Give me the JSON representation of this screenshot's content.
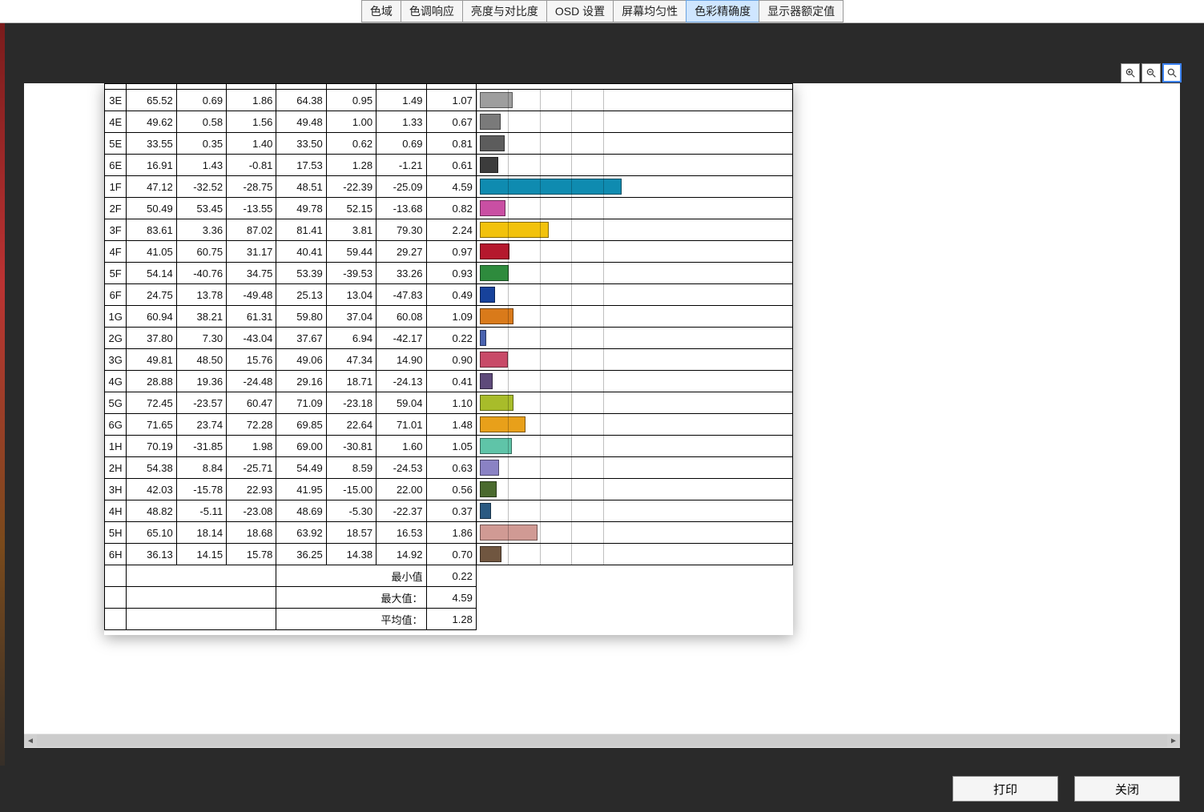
{
  "tabs": [
    "色域",
    "色调响应",
    "亮度与对比度",
    "OSD 设置",
    "屏幕均匀性",
    "色彩精确度",
    "显示器额定值"
  ],
  "active_tab_index": 5,
  "icons": {
    "zoom_in": "zoom-in-icon",
    "zoom_out": "zoom-out-icon",
    "zoom_fit": "zoom-fit-icon"
  },
  "buttons": {
    "print": "打印",
    "close": "关闭"
  },
  "summary_labels": {
    "min": "最小值",
    "max": "最大值：",
    "avg": "平均值："
  },
  "summary_values": {
    "min": "0.22",
    "max": "4.59",
    "avg": "1.28"
  },
  "chart_data": {
    "type": "bar",
    "xlabel": "",
    "ylabel": "",
    "xlim": [
      0,
      10
    ],
    "rows": [
      {
        "id": "3E",
        "c1": "65.52",
        "c2": "0.69",
        "c3": "1.86",
        "c4": "64.38",
        "c5": "0.95",
        "c6": "1.49",
        "value": 1.07,
        "color": "#9e9e9e"
      },
      {
        "id": "4E",
        "c1": "49.62",
        "c2": "0.58",
        "c3": "1.56",
        "c4": "49.48",
        "c5": "1.00",
        "c6": "1.33",
        "value": 0.67,
        "color": "#7a7a7a"
      },
      {
        "id": "5E",
        "c1": "33.55",
        "c2": "0.35",
        "c3": "1.40",
        "c4": "33.50",
        "c5": "0.62",
        "c6": "0.69",
        "value": 0.81,
        "color": "#5c5c5c"
      },
      {
        "id": "6E",
        "c1": "16.91",
        "c2": "1.43",
        "c3": "-0.81",
        "c4": "17.53",
        "c5": "1.28",
        "c6": "-1.21",
        "value": 0.61,
        "color": "#3c3c3c"
      },
      {
        "id": "1F",
        "c1": "47.12",
        "c2": "-32.52",
        "c3": "-28.75",
        "c4": "48.51",
        "c5": "-22.39",
        "c6": "-25.09",
        "value": 4.59,
        "color": "#0f8bb0"
      },
      {
        "id": "2F",
        "c1": "50.49",
        "c2": "53.45",
        "c3": "-13.55",
        "c4": "49.78",
        "c5": "52.15",
        "c6": "-13.68",
        "value": 0.82,
        "color": "#c94fa3"
      },
      {
        "id": "3F",
        "c1": "83.61",
        "c2": "3.36",
        "c3": "87.02",
        "c4": "81.41",
        "c5": "3.81",
        "c6": "79.30",
        "value": 2.24,
        "color": "#f2c20c"
      },
      {
        "id": "4F",
        "c1": "41.05",
        "c2": "60.75",
        "c3": "31.17",
        "c4": "40.41",
        "c5": "59.44",
        "c6": "29.27",
        "value": 0.97,
        "color": "#b5182d"
      },
      {
        "id": "5F",
        "c1": "54.14",
        "c2": "-40.76",
        "c3": "34.75",
        "c4": "53.39",
        "c5": "-39.53",
        "c6": "33.26",
        "value": 0.93,
        "color": "#2e8b3d"
      },
      {
        "id": "6F",
        "c1": "24.75",
        "c2": "13.78",
        "c3": "-49.48",
        "c4": "25.13",
        "c5": "13.04",
        "c6": "-47.83",
        "value": 0.49,
        "color": "#17429b"
      },
      {
        "id": "1G",
        "c1": "60.94",
        "c2": "38.21",
        "c3": "61.31",
        "c4": "59.80",
        "c5": "37.04",
        "c6": "60.08",
        "value": 1.09,
        "color": "#d97a1a"
      },
      {
        "id": "2G",
        "c1": "37.80",
        "c2": "7.30",
        "c3": "-43.04",
        "c4": "37.67",
        "c5": "6.94",
        "c6": "-42.17",
        "value": 0.22,
        "color": "#4a63b0"
      },
      {
        "id": "3G",
        "c1": "49.81",
        "c2": "48.50",
        "c3": "15.76",
        "c4": "49.06",
        "c5": "47.34",
        "c6": "14.90",
        "value": 0.9,
        "color": "#c84a68"
      },
      {
        "id": "4G",
        "c1": "28.88",
        "c2": "19.36",
        "c3": "-24.48",
        "c4": "29.16",
        "c5": "18.71",
        "c6": "-24.13",
        "value": 0.41,
        "color": "#5e4a7a"
      },
      {
        "id": "5G",
        "c1": "72.45",
        "c2": "-23.57",
        "c3": "60.47",
        "c4": "71.09",
        "c5": "-23.18",
        "c6": "59.04",
        "value": 1.1,
        "color": "#a8bc2a"
      },
      {
        "id": "6G",
        "c1": "71.65",
        "c2": "23.74",
        "c3": "72.28",
        "c4": "69.85",
        "c5": "22.64",
        "c6": "71.01",
        "value": 1.48,
        "color": "#e8a01a"
      },
      {
        "id": "1H",
        "c1": "70.19",
        "c2": "-31.85",
        "c3": "1.98",
        "c4": "69.00",
        "c5": "-30.81",
        "c6": "1.60",
        "value": 1.05,
        "color": "#5fc4a8"
      },
      {
        "id": "2H",
        "c1": "54.38",
        "c2": "8.84",
        "c3": "-25.71",
        "c4": "54.49",
        "c5": "8.59",
        "c6": "-24.53",
        "value": 0.63,
        "color": "#8a82c4"
      },
      {
        "id": "3H",
        "c1": "42.03",
        "c2": "-15.78",
        "c3": "22.93",
        "c4": "41.95",
        "c5": "-15.00",
        "c6": "22.00",
        "value": 0.56,
        "color": "#4a6a2e"
      },
      {
        "id": "4H",
        "c1": "48.82",
        "c2": "-5.11",
        "c3": "-23.08",
        "c4": "48.69",
        "c5": "-5.30",
        "c6": "-22.37",
        "value": 0.37,
        "color": "#2a5a82"
      },
      {
        "id": "5H",
        "c1": "65.10",
        "c2": "18.14",
        "c3": "18.68",
        "c4": "63.92",
        "c5": "18.57",
        "c6": "16.53",
        "value": 1.86,
        "color": "#d09a94"
      },
      {
        "id": "6H",
        "c1": "36.13",
        "c2": "14.15",
        "c3": "15.78",
        "c4": "36.25",
        "c5": "14.38",
        "c6": "14.92",
        "value": 0.7,
        "color": "#705640"
      }
    ]
  }
}
